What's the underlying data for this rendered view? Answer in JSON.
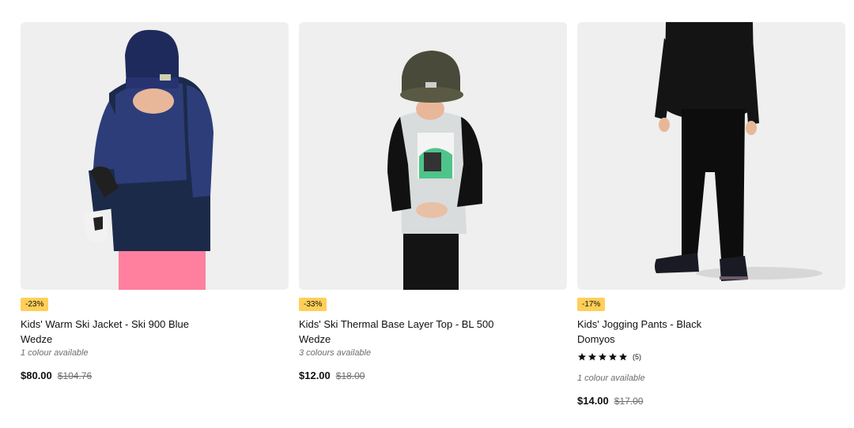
{
  "products": [
    {
      "discount": "-23%",
      "title": "Kids' Warm Ski Jacket - Ski 900 Blue",
      "brand": "Wedze",
      "colours": "1 colour available",
      "price": "$80.00",
      "old_price": "$104.76"
    },
    {
      "discount": "-33%",
      "title": "Kids' Ski Thermal Base Layer Top - BL 500",
      "brand": "Wedze",
      "colours": "3 colours available",
      "price": "$12.00",
      "old_price": "$18.00"
    },
    {
      "discount": "-17%",
      "title": "Kids' Jogging Pants - Black",
      "brand": "Domyos",
      "rating_stars": 5,
      "rating_count": "(5)",
      "colours": "1 colour available",
      "price": "$14.00",
      "old_price": "$17.00"
    }
  ],
  "colors": {
    "badge": "#ffcf58",
    "image_bg": "#eeefee",
    "muted_text": "#6d6d6d"
  }
}
